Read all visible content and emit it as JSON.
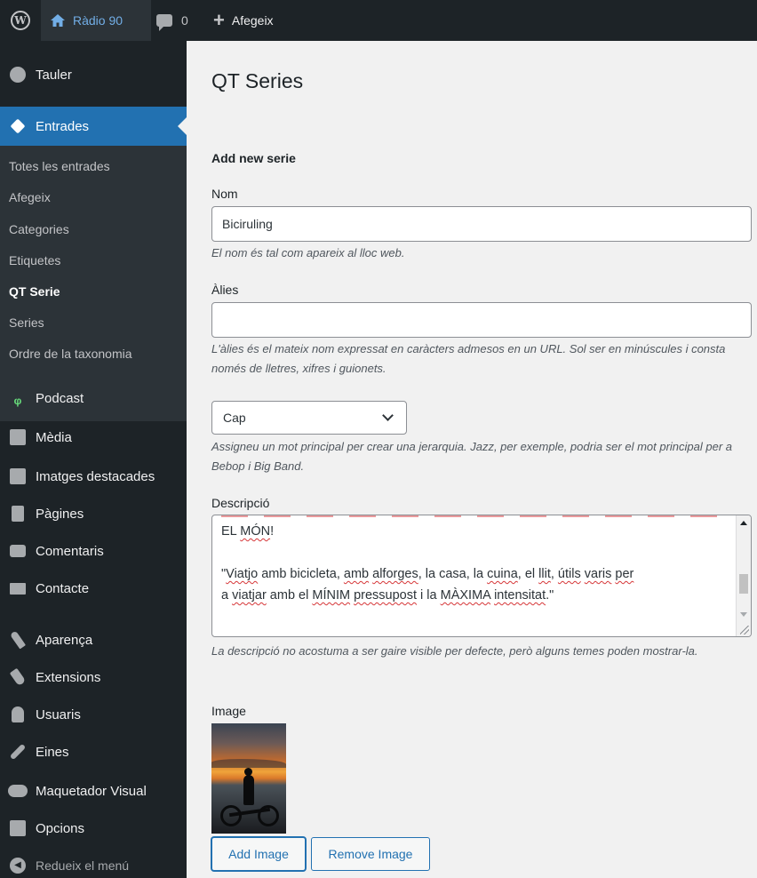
{
  "adminbar": {
    "site_name": "Ràdio 90",
    "comments_count": "0",
    "new_label": "Afegeix"
  },
  "sidebar": {
    "dashboard": "Tauler",
    "posts": "Entrades",
    "submenu": [
      "Totes les entrades",
      "Afegeix",
      "Categories",
      "Etiquetes",
      "QT Serie",
      "Series",
      "Ordre de la taxonomia"
    ],
    "items": [
      "Podcast",
      "Mèdia",
      "Imatges destacades",
      "Pàgines",
      "Comentaris",
      "Contacte",
      "Aparença",
      "Extensions",
      "Usuaris",
      "Eines",
      "Maquetador Visual",
      "Opcions"
    ],
    "collapse": "Redueix el menú"
  },
  "main": {
    "page_title": "QT Series",
    "form_title": "Add new serie",
    "name_label": "Nom",
    "name_value": "Biciruling",
    "name_desc": "El nom és tal com apareix al lloc web.",
    "slug_label": "Àlies",
    "slug_value": "",
    "slug_desc": "L'àlies és el mateix nom expressat en caràcters admesos en un URL. Sol ser en minúscules i consta només de lletres, xifres i guionets.",
    "parent_value": "Cap",
    "parent_desc": "Assigneu un mot principal per crear una jerarquia. Jazz, per exemple, podria ser el mot principal per a Bebop i Big Band.",
    "description_label": "Descripció",
    "description_lines": [
      "EL MÓN!",
      "",
      "\"Viatjo amb bicicleta, amb alforges, la casa, la cuina, el llit, útils varis per",
      "a viatjar amb el MÍNIM pressupost i la MÀXIMA intensitat.\""
    ],
    "description_desc": "La descripció no acostuma a ser gaire visible per defecte, però alguns temes poden mostrar-la.",
    "image_label": "Image",
    "add_image": "Add Image",
    "remove_image": "Remove Image"
  }
}
